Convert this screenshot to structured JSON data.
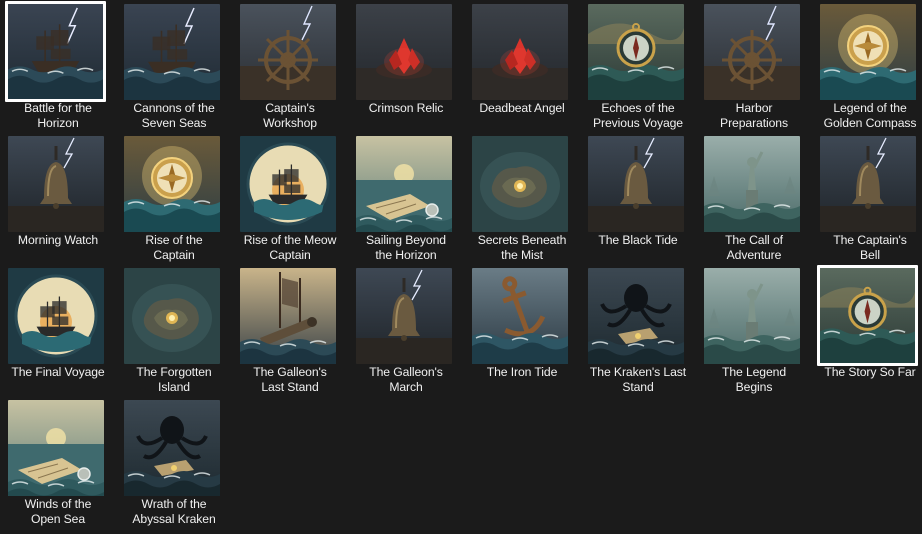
{
  "items": [
    {
      "label": "Battle for the\nHorizon",
      "icon": "ship-storm-thumbnail",
      "selected": true
    },
    {
      "label": "Cannons of the\nSeven Seas",
      "icon": "ship-storm-thumbnail",
      "selected": false
    },
    {
      "label": "Captain's\nWorkshop",
      "icon": "ship-wheel-thumbnail",
      "selected": false
    },
    {
      "label": "Crimson Relic",
      "icon": "red-crystal-thumbnail",
      "selected": false
    },
    {
      "label": "Deadbeat Angel",
      "icon": "red-crystal-thumbnail",
      "selected": false
    },
    {
      "label": "Echoes of the\nPrevious Voyage",
      "icon": "compass-thumbnail",
      "selected": false
    },
    {
      "label": "Harbor\nPreparations",
      "icon": "ship-wheel-thumbnail",
      "selected": false
    },
    {
      "label": "Legend of the\nGolden Compass",
      "icon": "golden-compass-thumbnail",
      "selected": false
    },
    {
      "label": "Morning Watch",
      "icon": "bell-thumbnail",
      "selected": false
    },
    {
      "label": "Rise of the\nCaptain",
      "icon": "golden-compass-thumbnail",
      "selected": false
    },
    {
      "label": "Rise of the Meow\nCaptain",
      "icon": "ship-emblem-thumbnail",
      "selected": false
    },
    {
      "label": "Sailing Beyond\nthe Horizon",
      "icon": "map-sea-thumbnail",
      "selected": false
    },
    {
      "label": "Secrets Beneath\nthe Mist",
      "icon": "island-map-thumbnail",
      "selected": false
    },
    {
      "label": "The Black Tide",
      "icon": "bell-thumbnail",
      "selected": false
    },
    {
      "label": "The Call of\nAdventure",
      "icon": "statue-thumbnail",
      "selected": false
    },
    {
      "label": "The Captain's\nBell",
      "icon": "bell-thumbnail",
      "selected": false
    },
    {
      "label": "The Final Voyage",
      "icon": "ship-emblem-thumbnail",
      "selected": false
    },
    {
      "label": "The Forgotten\nIsland",
      "icon": "island-map-thumbnail",
      "selected": false
    },
    {
      "label": "The Galleon's\nLast Stand",
      "icon": "cannon-thumbnail",
      "selected": false
    },
    {
      "label": "The Galleon's\nMarch",
      "icon": "bell-thumbnail",
      "selected": false
    },
    {
      "label": "The Iron Tide",
      "icon": "anchor-thumbnail",
      "selected": false
    },
    {
      "label": "The Kraken's Last\nStand",
      "icon": "kraken-thumbnail",
      "selected": false
    },
    {
      "label": "The Legend\nBegins",
      "icon": "statue-thumbnail",
      "selected": false
    },
    {
      "label": "The Story So Far",
      "icon": "compass-thumbnail",
      "selected": true
    },
    {
      "label": "Winds of the\nOpen Sea",
      "icon": "map-sea-thumbnail",
      "selected": false
    },
    {
      "label": "Wrath of the\nAbyssal Kraken",
      "icon": "kraken-thumbnail",
      "selected": false
    }
  ],
  "colors": {
    "background": "#1b1b1b",
    "label": "#f0f0f0",
    "selection_border": "#ffffff"
  }
}
